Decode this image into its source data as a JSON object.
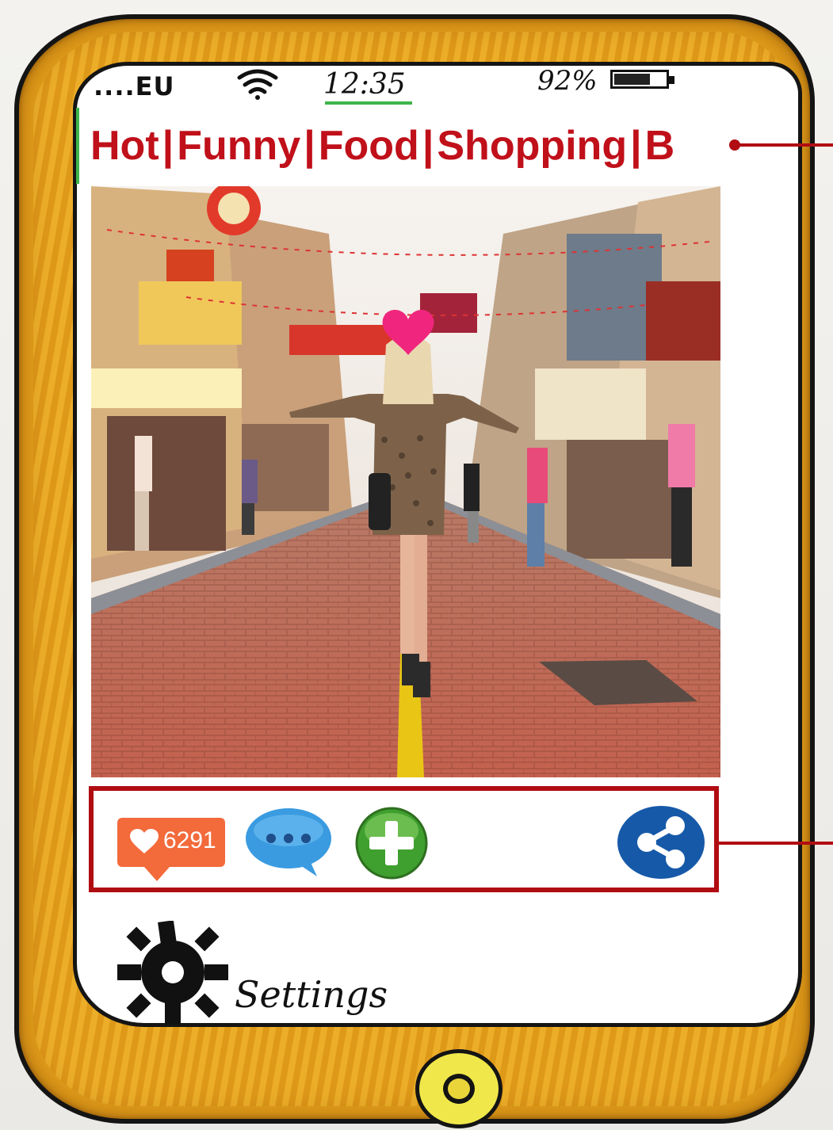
{
  "status_bar": {
    "carrier": "....EU",
    "time": "12:35",
    "battery_percent": "92%",
    "battery_level": 0.7
  },
  "categories": [
    {
      "label": "Hot"
    },
    {
      "label": "Funny"
    },
    {
      "label": "Food"
    },
    {
      "label": "Shopping"
    },
    {
      "label": "B"
    }
  ],
  "category_separator": "|",
  "photo": {
    "icon": "heart-face-sticker"
  },
  "actions": {
    "like_count": "6291",
    "like_icon": "heart-icon",
    "comment_icon": "speech-bubble-icon",
    "add_icon": "plus-icon",
    "share_icon": "share-icon"
  },
  "settings": {
    "label": "Settings",
    "icon": "gear-icon"
  },
  "colors": {
    "accent_red": "#c0101a",
    "phone_orange": "#e6a21b",
    "like_orange": "#f36a3b",
    "comment_blue": "#3a9be0",
    "add_green": "#3f9f2f",
    "share_blue": "#1659a8"
  }
}
